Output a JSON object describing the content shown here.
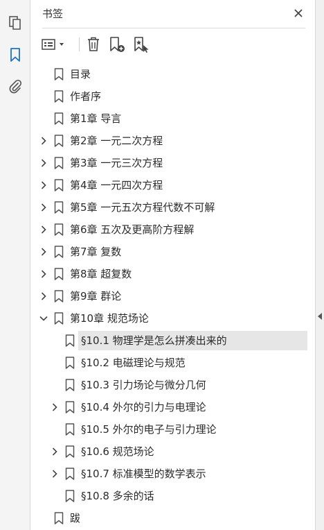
{
  "panel": {
    "title": "书签"
  },
  "tree": [
    {
      "label": "目录",
      "level": 0,
      "expand": "none",
      "selected": false
    },
    {
      "label": "作者序",
      "level": 0,
      "expand": "none",
      "selected": false
    },
    {
      "label": "第1章 导言",
      "level": 0,
      "expand": "none",
      "selected": false
    },
    {
      "label": "第2章 一元二次方程",
      "level": 0,
      "expand": "collapsed",
      "selected": false
    },
    {
      "label": "第3章 一元三次方程",
      "level": 0,
      "expand": "collapsed",
      "selected": false
    },
    {
      "label": "第4章 一元四次方程",
      "level": 0,
      "expand": "collapsed",
      "selected": false
    },
    {
      "label": "第5章 一元五次方程代数不可解",
      "level": 0,
      "expand": "collapsed",
      "selected": false
    },
    {
      "label": "第6章 五次及更高阶方程解",
      "level": 0,
      "expand": "collapsed",
      "selected": false
    },
    {
      "label": "第7章 复数",
      "level": 0,
      "expand": "collapsed",
      "selected": false
    },
    {
      "label": "第8章 超复数",
      "level": 0,
      "expand": "collapsed",
      "selected": false
    },
    {
      "label": "第9章 群论",
      "level": 0,
      "expand": "collapsed",
      "selected": false
    },
    {
      "label": "第10章 规范场论",
      "level": 0,
      "expand": "expanded",
      "selected": false
    },
    {
      "label": "§10.1 物理学是怎么拼凑出来的",
      "level": 1,
      "expand": "none",
      "selected": true
    },
    {
      "label": "§10.2 电磁理论与规范",
      "level": 1,
      "expand": "none",
      "selected": false
    },
    {
      "label": "§10.3 引力场论与微分几何",
      "level": 1,
      "expand": "none",
      "selected": false
    },
    {
      "label": "§10.4 外尔的引力与电理论",
      "level": 1,
      "expand": "collapsed",
      "selected": false
    },
    {
      "label": "§10.5 外尔的电子与引力理论",
      "level": 1,
      "expand": "none",
      "selected": false
    },
    {
      "label": "§10.6 规范场论",
      "level": 1,
      "expand": "collapsed",
      "selected": false
    },
    {
      "label": "§10.7 标准模型的数学表示",
      "level": 1,
      "expand": "collapsed",
      "selected": false
    },
    {
      "label": "§10.8 多余的话",
      "level": 1,
      "expand": "none",
      "selected": false
    },
    {
      "label": "跋",
      "level": 0,
      "expand": "none",
      "selected": false
    }
  ],
  "icons": {
    "rail": [
      "pages-icon",
      "bookmarks-icon",
      "attachments-icon"
    ],
    "toolbar": [
      "options-icon",
      "delete-icon",
      "new-bookmark-icon",
      "bookmark-from-selection-icon"
    ]
  },
  "colors": {
    "accent": "#1a73c7",
    "selected_row": "#e6e6e6",
    "icon": "#555555"
  }
}
